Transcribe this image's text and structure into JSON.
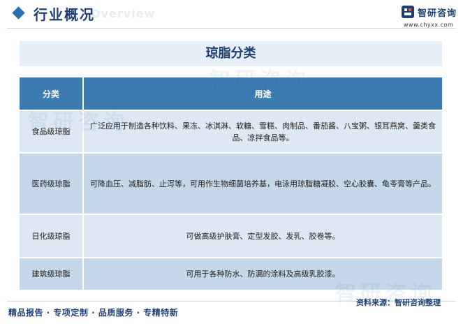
{
  "header": {
    "section_title": "行业概况",
    "section_subtitle": "Overview",
    "brand_name": "智研咨询",
    "brand_url": "www.chyxx.com"
  },
  "main": {
    "title": "琼脂分类",
    "columns": [
      "分类",
      "用途"
    ],
    "rows": [
      {
        "category": "食品级琼脂",
        "usage": "广泛应用于制造各种饮料、果冻、冰淇淋、软糖、雪糕、肉制品、番茄酱、八宝粥、银耳燕窝、羹类食品、凉拌食品等。"
      },
      {
        "category": "医药级琼脂",
        "usage": "可降血压、减脂肪、止泻等，可用作生物细菌培养基，电泳用琼脂糖凝胶、空心胶囊、龟苓膏等产品。"
      },
      {
        "category": "日化级琼脂",
        "usage": "可做高级护肤膏、定型发胶、发乳、胶卷等。"
      },
      {
        "category": "建筑级琼脂",
        "usage": "可用于各种防水、防漏的涂料及高级乳胶漆。"
      }
    ]
  },
  "footer": {
    "services": "精品报告 · 专项定制 · 品质服务 · 专精特新",
    "source": "资料来源：智研咨询整理"
  },
  "watermark": {
    "text": "智研咨询"
  },
  "colors": {
    "primary": "#1f3f73",
    "header_cell": "#3b7bb0",
    "row_light": "#dde8f3",
    "row_dark": "#c5d8ea"
  }
}
